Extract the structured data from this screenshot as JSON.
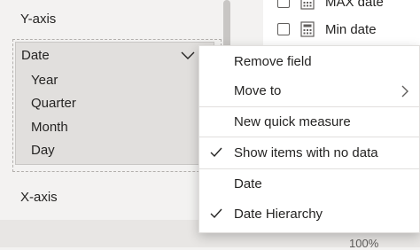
{
  "visualizations_pane": {
    "yaxis_title": "Y-axis",
    "field": {
      "name": "Date",
      "hierarchy": [
        "Year",
        "Quarter",
        "Month",
        "Day"
      ]
    },
    "xaxis_title": "X-axis"
  },
  "fields_list": {
    "items": [
      {
        "label": "MAX date",
        "icon": "calculator-icon"
      },
      {
        "label": "Min date",
        "icon": "calculator-icon"
      }
    ]
  },
  "context_menu": {
    "items": [
      {
        "label": "Remove field",
        "checked": false,
        "submenu": false
      },
      {
        "label": "Move to",
        "checked": false,
        "submenu": true
      },
      {
        "label": "New quick measure",
        "checked": false,
        "submenu": false
      },
      {
        "label": "Show items with no data",
        "checked": true,
        "submenu": false
      },
      {
        "label": "Date",
        "checked": false,
        "submenu": false
      },
      {
        "label": "Date Hierarchy",
        "checked": true,
        "submenu": false
      }
    ]
  },
  "status_bar": {
    "zoom": "100%"
  },
  "colors": {
    "pane_bg": "#f3f2f1",
    "menu_bg": "#ffffff",
    "text": "#252423",
    "separator": "#e1dfdd"
  }
}
